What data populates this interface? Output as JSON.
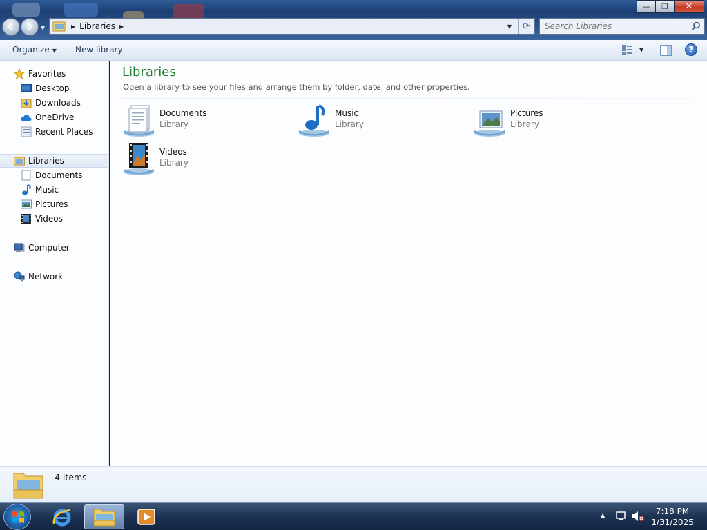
{
  "window": {
    "minimize_glyph": "—",
    "maximize_glyph": "❐",
    "close_glyph": "✕"
  },
  "address": {
    "path": "Libraries",
    "search_placeholder": "Search Libraries"
  },
  "toolbar": {
    "organize_label": "Organize",
    "new_library_label": "New library",
    "help_glyph": "?"
  },
  "nav": {
    "favorites": {
      "label": "Favorites",
      "items": [
        "Desktop",
        "Downloads",
        "OneDrive",
        "Recent Places"
      ]
    },
    "libraries": {
      "label": "Libraries",
      "items": [
        "Documents",
        "Music",
        "Pictures",
        "Videos"
      ]
    },
    "computer": "Computer",
    "network": "Network"
  },
  "content": {
    "title": "Libraries",
    "description": "Open a library to see your files and arrange them by folder, date, and other properties.",
    "libraries": [
      {
        "name": "Documents",
        "kind": "Library",
        "icon": "documents-library-icon"
      },
      {
        "name": "Music",
        "kind": "Library",
        "icon": "music-library-icon"
      },
      {
        "name": "Pictures",
        "kind": "Library",
        "icon": "pictures-library-icon"
      },
      {
        "name": "Videos",
        "kind": "Library",
        "icon": "videos-library-icon"
      }
    ]
  },
  "details": {
    "count": "4 items"
  },
  "taskbar": {
    "apps": [
      "internet-explorer",
      "windows-explorer",
      "media-player"
    ],
    "time": "7:18 PM",
    "date": "1/31/2025"
  },
  "colors": {
    "title_green": "#1e7a2c",
    "selection": "#dfe8f5",
    "taskbar": "#1d3252"
  }
}
